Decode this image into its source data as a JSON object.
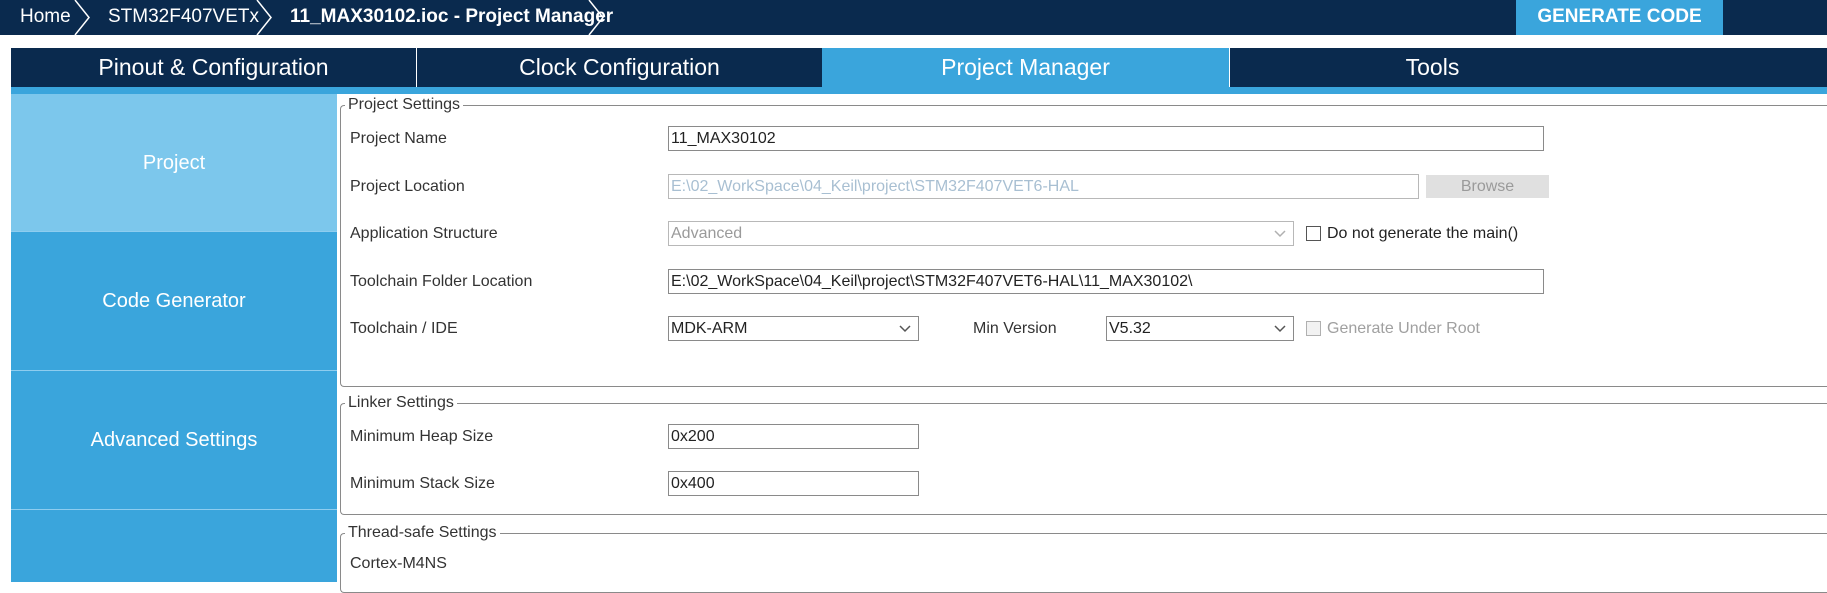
{
  "breadcrumb": {
    "home": "Home",
    "chip": "STM32F407VETx",
    "project": "11_MAX30102.ioc - Project Manager"
  },
  "toolbar": {
    "generate_code": "GENERATE CODE"
  },
  "tabs": [
    {
      "label": "Pinout & Configuration"
    },
    {
      "label": "Clock Configuration"
    },
    {
      "label": "Project Manager"
    },
    {
      "label": "Tools"
    }
  ],
  "sidebar": {
    "items": [
      {
        "label": "Project"
      },
      {
        "label": "Code Generator"
      },
      {
        "label": "Advanced Settings"
      }
    ]
  },
  "project_settings": {
    "legend": "Project Settings",
    "project_name_label": "Project Name",
    "project_name_value": "11_MAX30102",
    "project_location_label": "Project Location",
    "project_location_value": "E:\\02_WorkSpace\\04_Keil\\project\\STM32F407VET6-HAL",
    "browse_label": "Browse",
    "app_structure_label": "Application Structure",
    "app_structure_value": "Advanced",
    "do_not_generate_main_label": "Do not generate the main()",
    "toolchain_folder_label": "Toolchain Folder Location",
    "toolchain_folder_value": "E:\\02_WorkSpace\\04_Keil\\project\\STM32F407VET6-HAL\\11_MAX30102\\",
    "toolchain_ide_label": "Toolchain / IDE",
    "toolchain_ide_value": "MDK-ARM",
    "min_version_label": "Min Version",
    "min_version_value": "V5.32",
    "generate_under_root_label": "Generate Under Root"
  },
  "linker_settings": {
    "legend": "Linker Settings",
    "heap_label": "Minimum Heap Size",
    "heap_value": "0x200",
    "stack_label": "Minimum Stack Size",
    "stack_value": "0x400"
  },
  "thread_safe_settings": {
    "legend": "Thread-safe Settings",
    "core_label": "Cortex-M4NS"
  },
  "colors": {
    "navy": "#0a2a4e",
    "accent_blue": "#3aa5dc",
    "sidebar_active": "#7cc7ec"
  }
}
